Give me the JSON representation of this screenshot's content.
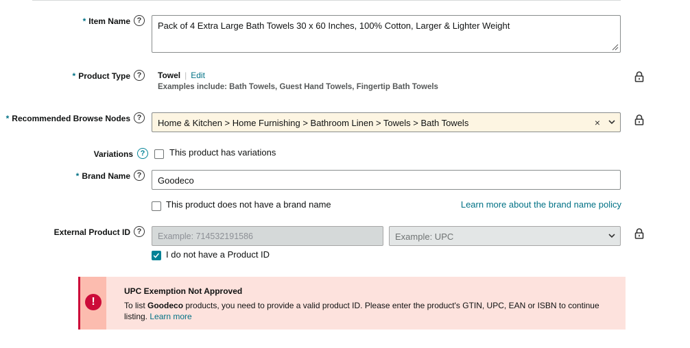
{
  "item_name": {
    "label": "Item Name",
    "required": "*",
    "value": "Pack of 4 Extra Large Bath Towels 30 x 60 Inches, 100% Cotton, Larger & Lighter Weight"
  },
  "product_type": {
    "label": "Product Type",
    "required": "*",
    "value": "Towel",
    "separator": "|",
    "edit_label": "Edit",
    "examples": "Examples include: Bath Towels, Guest Hand Towels, Fingertip Bath Towels"
  },
  "browse_nodes": {
    "label": "Recommended Browse Nodes",
    "required": "*",
    "value": "Home & Kitchen > Home Furnishing > Bathroom Linen > Towels > Bath Towels",
    "clear_glyph": "×"
  },
  "variations": {
    "label": "Variations",
    "checkbox_label": "This product has variations",
    "checked": false
  },
  "brand_name": {
    "label": "Brand Name",
    "required": "*",
    "value": "Goodeco",
    "no_brand_label": "This product does not have a brand name",
    "no_brand_checked": false,
    "policy_link": "Learn more about the brand name policy"
  },
  "external_product_id": {
    "label": "External Product ID",
    "id_placeholder": "Example: 714532191586",
    "type_placeholder": "Example: UPC",
    "no_id_label": "I do not have a Product ID",
    "no_id_checked": true
  },
  "alert": {
    "icon": "!",
    "title": "UPC Exemption Not Approved",
    "msg_prefix": "To list ",
    "msg_brand": "Goodeco",
    "msg_suffix": " products, you need to provide a valid product ID. Please enter the product's GTIN, UPC, EAN or ISBN to continue listing.",
    "link": "Learn more"
  },
  "help_glyph": "?",
  "colors": {
    "link": "#007185",
    "error": "#cc0c39",
    "alert_bg": "#fde2dd",
    "browse_bg": "#fdf5e2",
    "checkbox_checked": "#008296"
  }
}
